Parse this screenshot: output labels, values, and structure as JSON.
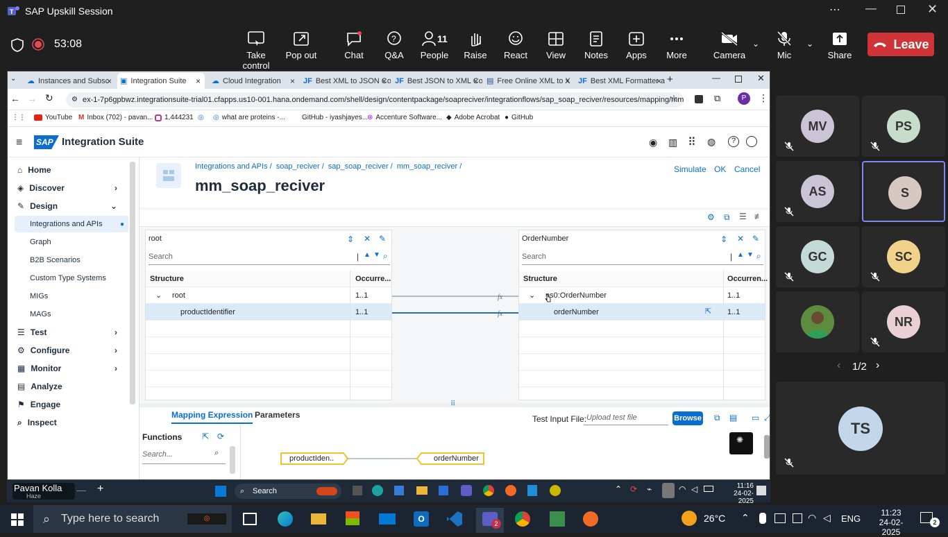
{
  "teams": {
    "title": "SAP Upskill Session",
    "timer": "53:08",
    "toolbar": [
      {
        "label": "Take control",
        "icon": "take-control-icon"
      },
      {
        "label": "Pop out",
        "icon": "pop-out-icon"
      },
      {
        "label": "Chat",
        "icon": "chat-icon"
      },
      {
        "label": "Q&A",
        "icon": "qa-icon"
      },
      {
        "label": "People",
        "icon": "people-icon",
        "count": "11"
      },
      {
        "label": "Raise",
        "icon": "raise-hand-icon"
      },
      {
        "label": "React",
        "icon": "react-icon"
      },
      {
        "label": "View",
        "icon": "view-icon"
      },
      {
        "label": "Notes",
        "icon": "notes-icon"
      },
      {
        "label": "Apps",
        "icon": "apps-icon"
      },
      {
        "label": "More",
        "icon": "more-icon"
      },
      {
        "label": "Camera",
        "icon": "camera-off-icon"
      },
      {
        "label": "Mic",
        "icon": "mic-off-icon"
      },
      {
        "label": "Share",
        "icon": "share-icon"
      }
    ],
    "leave": "Leave",
    "presenter": "Pavan Kolla",
    "presenter_sub": "Haze",
    "pager": "1/2",
    "participants": [
      {
        "initials": "MV",
        "color": "#c9c4d6"
      },
      {
        "initials": "PS",
        "color": "#c8dccb"
      },
      {
        "initials": "AS",
        "color": "#c9c4d6"
      },
      {
        "initials": "S",
        "color": "#d8c8c4",
        "active": true
      },
      {
        "initials": "GC",
        "color": "#c4dad7"
      },
      {
        "initials": "SC",
        "color": "#f0d28a"
      },
      {
        "initials": "",
        "color": "#4a7a3a",
        "photo": true
      },
      {
        "initials": "NR",
        "color": "#ead0d6"
      }
    ],
    "large_tile": {
      "initials": "TS",
      "color": "#c4d7ea"
    }
  },
  "browser": {
    "tabs": [
      {
        "label": "Instances and Subsc",
        "active": false
      },
      {
        "label": "Integration Suite",
        "active": true
      },
      {
        "label": "Cloud Integration",
        "active": false
      },
      {
        "label": "Best XML to JSON Co",
        "active": false
      },
      {
        "label": "Best JSON to XML Co",
        "active": false
      },
      {
        "label": "Free Online XML to X",
        "active": false
      },
      {
        "label": "Best XML Formatter a",
        "active": false
      }
    ],
    "url": "ex-1-7p6gpbwz.integrationsuite-trial01.cfapps.us10-001.hana.ondemand.com/shell/design/contentpackage/soapreciver/integrationflows/sap_soap_reciver/resources/mapping/mm_soap_...",
    "profile_initial": "P",
    "bookmarks": [
      {
        "label": "YouTube",
        "color": "#e62117"
      },
      {
        "label": "Inbox (702) - pavan...",
        "color": "#d93025"
      },
      {
        "label": "1,444231",
        "color": "#c13584"
      },
      {
        "label": "",
        "color": "#1a73e8"
      },
      {
        "label": "what are proteins -...",
        "color": "#1a73e8"
      },
      {
        "label": "GitHub - iyashjayes...",
        "color": "#333333"
      },
      {
        "label": "Accenture Software...",
        "color": "#a100ff"
      },
      {
        "label": "Adobe Acrobat",
        "color": "#222222"
      },
      {
        "label": "GitHub",
        "color": "#222222"
      }
    ]
  },
  "sap": {
    "product": "Integration Suite",
    "nav": [
      {
        "label": "Home",
        "level": 0,
        "icon": "home-icon"
      },
      {
        "label": "Discover",
        "level": 0,
        "icon": "discover-icon",
        "chevron": ">"
      },
      {
        "label": "Design",
        "level": 0,
        "icon": "design-icon",
        "chevron": "v"
      },
      {
        "label": "Integrations and APIs",
        "level": 1,
        "selected": true
      },
      {
        "label": "Graph",
        "level": 1
      },
      {
        "label": "B2B Scenarios",
        "level": 1
      },
      {
        "label": "Custom Type Systems",
        "level": 1
      },
      {
        "label": "MIGs",
        "level": 1
      },
      {
        "label": "MAGs",
        "level": 1
      },
      {
        "label": "Test",
        "level": 0,
        "icon": "test-icon",
        "chevron": ">"
      },
      {
        "label": "Configure",
        "level": 0,
        "icon": "configure-icon",
        "chevron": ">"
      },
      {
        "label": "Monitor",
        "level": 0,
        "icon": "monitor-icon",
        "chevron": ">"
      },
      {
        "label": "Analyze",
        "level": 0,
        "icon": "analyze-icon"
      },
      {
        "label": "Engage",
        "level": 0,
        "icon": "engage-icon"
      },
      {
        "label": "Inspect",
        "level": 0,
        "icon": "inspect-icon"
      }
    ],
    "breadcrumb": [
      "Integrations and APIs /",
      "soap_reciver /",
      "sap_soap_reciver /",
      "mm_soap_reciver /"
    ],
    "page_title": "mm_soap_reciver",
    "actions": {
      "simulate": "Simulate",
      "ok": "OK",
      "cancel": "Cancel"
    },
    "source": {
      "title": "root",
      "search_placeholder": "Search",
      "headers": {
        "structure": "Structure",
        "occurrence": "Occurre..."
      },
      "rows": [
        {
          "name": "root",
          "occ": "1..1",
          "expanded": true
        },
        {
          "name": "productIdentifier",
          "occ": "1..1",
          "highlight": true
        }
      ]
    },
    "target": {
      "title": "OrderNumber",
      "search_placeholder": "Search",
      "headers": {
        "structure": "Structure",
        "occurrence": "Occurren..."
      },
      "rows": [
        {
          "name": "ns0:OrderNumber",
          "occ": "1..1",
          "expanded": true
        },
        {
          "name": "orderNumber",
          "occ": "1..1",
          "highlight": true
        }
      ]
    },
    "bottom": {
      "tabs": [
        "Mapping Expression",
        "Parameters"
      ],
      "test_input_label": "Test Input File:",
      "upload_placeholder": "Upload test file",
      "browse": "Browse",
      "functions_title": "Functions",
      "functions_search": "Search...",
      "expr_source": "productIden..",
      "expr_target": "orderNumber"
    }
  },
  "inner_taskbar": {
    "search": "Search",
    "time": "11:16",
    "date": "24-02-2025"
  },
  "win_taskbar": {
    "search": "Type here to search",
    "weather": "26°C",
    "lang": "ENG",
    "time": "11:23",
    "date": "24-02-2025",
    "notif": "2",
    "teams_badge": "2"
  }
}
